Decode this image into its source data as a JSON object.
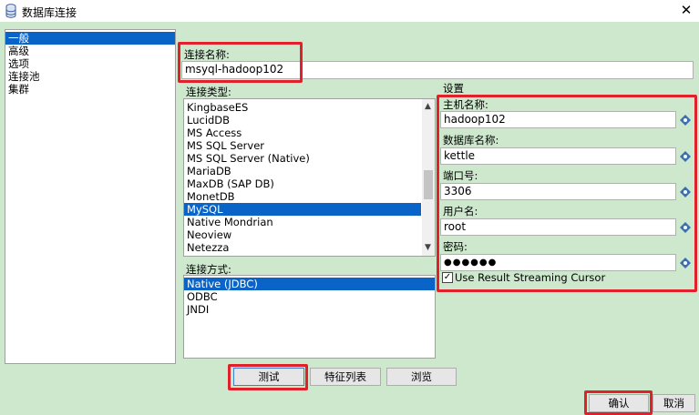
{
  "window": {
    "title": "数据库连接",
    "close_glyph": "✕"
  },
  "sidebar": {
    "items": [
      {
        "label": "一般",
        "selected": true
      },
      {
        "label": "高级"
      },
      {
        "label": "选项"
      },
      {
        "label": "连接池"
      },
      {
        "label": "集群"
      }
    ]
  },
  "connection_name": {
    "label": "连接名称:",
    "value": "msyql-hadoop102"
  },
  "connection_type": {
    "label": "连接类型:",
    "items": [
      "KingbaseES",
      "LucidDB",
      "MS Access",
      "MS SQL Server",
      "MS SQL Server (Native)",
      "MariaDB",
      "MaxDB (SAP DB)",
      "MonetDB",
      "MySQL",
      "Native Mondrian",
      "Neoview",
      "Netezza"
    ],
    "selected": "MySQL"
  },
  "access_method": {
    "label": "连接方式:",
    "items": [
      "Native (JDBC)",
      "ODBC",
      "JNDI"
    ],
    "selected": "Native (JDBC)"
  },
  "settings": {
    "title": "设置",
    "host_label": "主机名称:",
    "host_value": "hadoop102",
    "db_label": "数据库名称:",
    "db_value": "kettle",
    "port_label": "端口号:",
    "port_value": "3306",
    "user_label": "用户名:",
    "user_value": "root",
    "password_label": "密码:",
    "password_value": "●●●●●●",
    "streaming_label": "Use Result Streaming Cursor",
    "streaming_checked": true
  },
  "buttons": {
    "test": "测试",
    "features": "特征列表",
    "browse": "浏览",
    "ok": "确认",
    "cancel": "取消"
  },
  "colors": {
    "accent_red": "#e0202a",
    "selection_blue": "#0a64c8",
    "background_green": "#cde8cd"
  }
}
